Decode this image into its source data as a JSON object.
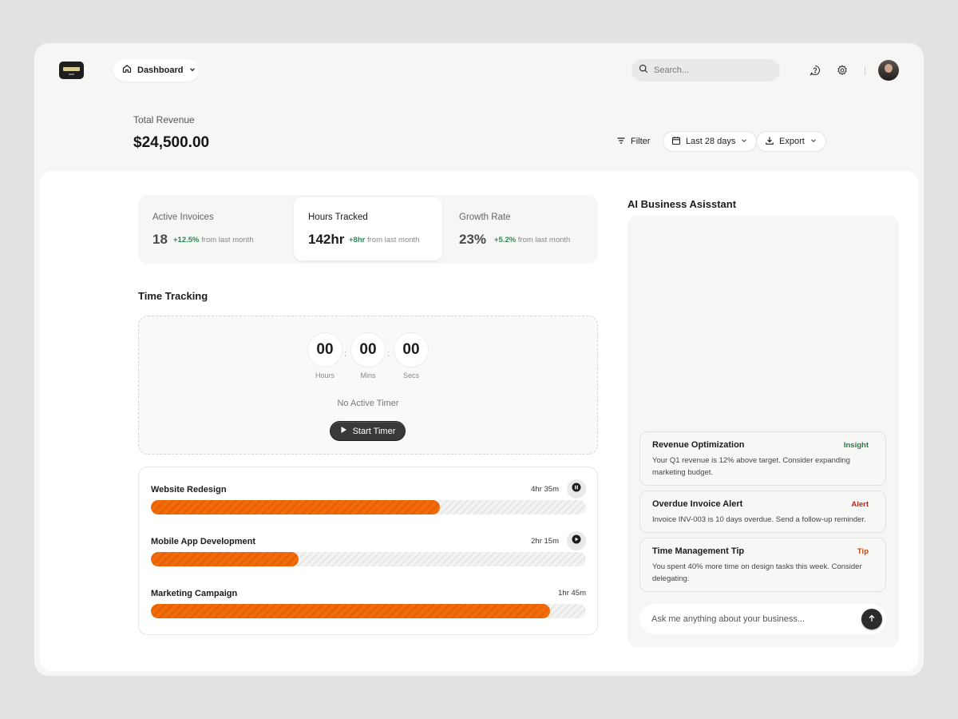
{
  "header": {
    "nav_label": "Dashboard",
    "search_placeholder": "Search..."
  },
  "revenue": {
    "label": "Total Revenue",
    "value": "$24,500.00"
  },
  "toolbar": {
    "filter_label": "Filter",
    "date_range_label": "Last 28 days",
    "export_label": "Export"
  },
  "stats": [
    {
      "label": "Active Invoices",
      "value": "18",
      "delta": "+12.5%",
      "delta_suffix": "from last month"
    },
    {
      "label": "Hours Tracked",
      "value": "142hr",
      "delta": "+8hr",
      "delta_suffix": "from last month"
    },
    {
      "label": "Growth Rate",
      "value": "23%",
      "delta": "+5.2%",
      "delta_suffix": "from last month"
    }
  ],
  "time_tracking": {
    "title": "Time Tracking",
    "hours": "00",
    "mins": "00",
    "secs": "00",
    "hours_caption": "Hours",
    "mins_caption": "Mins",
    "secs_caption": "Secs",
    "colon": ":",
    "status": "No Active Timer",
    "start_label": "Start Timer"
  },
  "projects": [
    {
      "name": "Website Redesign",
      "time": "4hr 35m",
      "progress": 0.665,
      "control": "pause-icon"
    },
    {
      "name": "Mobile App Development",
      "time": "2hr 15m",
      "progress": 0.34,
      "control": "play-icon"
    },
    {
      "name": "Marketing Campaign",
      "time": "1hr 45m",
      "progress": 0.918,
      "control": null
    }
  ],
  "assistant": {
    "title": "AI Business Asisstant",
    "cards": [
      {
        "title": "Revenue Optimization",
        "tag": "Insight",
        "tag_color": "#2d7a4a",
        "text": "Your Q1 revenue is 12% above target. Consider expanding marketing budget."
      },
      {
        "title": "Overdue Invoice Alert",
        "tag": "Alert",
        "tag_color": "#b3261e",
        "text": "Invoice INV-003 is 10 days overdue. Send a follow-up reminder."
      },
      {
        "title": "Time Management Tip",
        "tag": "Tip",
        "tag_color": "#c2410c",
        "text": "You spent 40% more time on design tasks this week. Consider delegating."
      }
    ],
    "input_placeholder": "Ask me anything about your business..."
  },
  "colors": {
    "accent": "#f26b0a",
    "positive": "#2d8a54"
  }
}
